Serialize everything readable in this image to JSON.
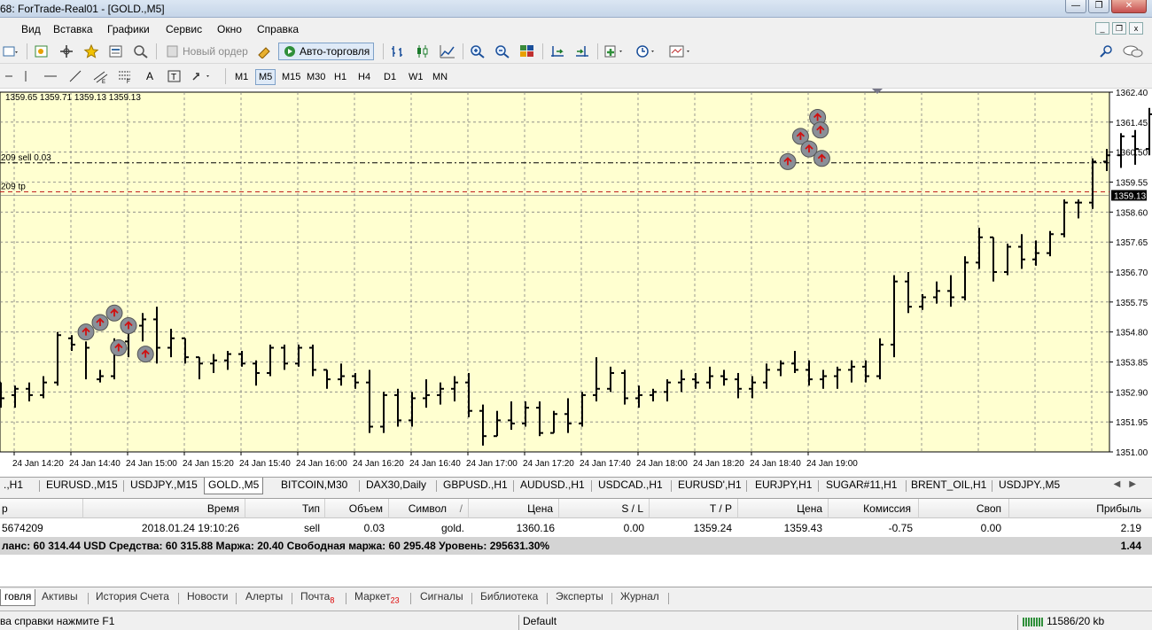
{
  "window": {
    "title": "68: ForTrade-Real01 - [GOLD.,M5]",
    "buttons": [
      "—",
      "❐",
      "✕"
    ]
  },
  "menu": [
    "Вид",
    "Вставка",
    "Графики",
    "Сервис",
    "Окно",
    "Справка"
  ],
  "toolbar1": {
    "new_order": "Новый ордер",
    "autotrading": "Авто-торговля"
  },
  "timeframes": [
    "M1",
    "M5",
    "M15",
    "M30",
    "H1",
    "H4",
    "D1",
    "W1",
    "MN"
  ],
  "active_timeframe": "M5",
  "chart": {
    "ohlc_label": "1359.65 1359.71 1359.13 1359.13",
    "order_label": "209 sell 0.03",
    "tp_label": "209 tp",
    "current_price_label": "1359.13",
    "background": "#ffffd0",
    "grid_color": "#808080",
    "candle_color": "#000000",
    "order_line_color": "#000000",
    "tp_line_color": "#c02020"
  },
  "chart_data": {
    "type": "bar",
    "title": "",
    "xlabel": "",
    "ylabel": "",
    "ylim": [
      1351.0,
      1362.4
    ],
    "y_ticks": [
      "1362.40",
      "1361.45",
      "1360.50",
      "1359.55",
      "1358.60",
      "1357.65",
      "1356.70",
      "1355.75",
      "1354.80",
      "1353.85",
      "1352.90",
      "1351.95",
      "1351.00"
    ],
    "x_ticks": [
      "24 Jan 14:20",
      "24 Jan 14:40",
      "24 Jan 15:00",
      "24 Jan 15:20",
      "24 Jan 15:40",
      "24 Jan 16:00",
      "24 Jan 16:20",
      "24 Jan 16:40",
      "24 Jan 17:00",
      "24 Jan 17:20",
      "24 Jan 17:40",
      "24 Jan 18:00",
      "24 Jan 18:20",
      "24 Jan 18:40",
      "24 Jan 19:00"
    ],
    "order_price": 1360.16,
    "tp_price": 1359.24,
    "current_price": 1359.13,
    "grid": true,
    "series": [
      {
        "bars": [
          [
            1353.2,
            1353.2,
            1352.4,
            1352.7
          ],
          [
            1352.8,
            1353.1,
            1352.4,
            1353.0
          ],
          [
            1353.0,
            1353.2,
            1352.6,
            1352.8
          ],
          [
            1352.8,
            1353.4,
            1352.7,
            1353.2
          ],
          [
            1353.2,
            1354.8,
            1353.1,
            1354.7
          ],
          [
            1354.6,
            1354.7,
            1354.2,
            1354.4
          ],
          [
            1354.6,
            1354.5,
            1353.3,
            1354.3
          ],
          [
            1353.3,
            1353.6,
            1353.2,
            1353.4
          ],
          [
            1353.4,
            1354.6,
            1353.3,
            1354.5
          ],
          [
            1354.5,
            1355.2,
            1354.0,
            1355.0
          ],
          [
            1355.0,
            1355.4,
            1354.5,
            1355.2
          ],
          [
            1355.2,
            1355.6,
            1353.8,
            1354.3
          ],
          [
            1354.3,
            1354.9,
            1354.0,
            1354.6
          ],
          [
            1354.6,
            1354.6,
            1353.8,
            1354.0
          ],
          [
            1354.0,
            1354.0,
            1353.3,
            1353.8
          ],
          [
            1353.8,
            1354.1,
            1353.5,
            1353.9
          ],
          [
            1353.9,
            1354.2,
            1353.6,
            1354.1
          ],
          [
            1354.1,
            1354.2,
            1353.7,
            1353.8
          ],
          [
            1353.8,
            1353.9,
            1353.1,
            1353.5
          ],
          [
            1353.5,
            1354.4,
            1353.4,
            1354.3
          ],
          [
            1354.3,
            1354.4,
            1353.6,
            1353.8
          ],
          [
            1353.8,
            1354.4,
            1353.7,
            1354.3
          ],
          [
            1354.3,
            1354.4,
            1353.4,
            1353.6
          ],
          [
            1353.6,
            1353.6,
            1353.0,
            1353.3
          ],
          [
            1353.3,
            1353.8,
            1353.1,
            1353.4
          ],
          [
            1353.4,
            1353.5,
            1353.0,
            1353.2
          ],
          [
            1353.2,
            1353.6,
            1351.6,
            1351.8
          ],
          [
            1351.8,
            1352.9,
            1351.6,
            1352.8
          ],
          [
            1352.8,
            1353.0,
            1351.8,
            1352.0
          ],
          [
            1352.0,
            1352.9,
            1351.8,
            1352.7
          ],
          [
            1352.7,
            1353.3,
            1352.4,
            1352.8
          ],
          [
            1352.8,
            1353.2,
            1352.5,
            1353.0
          ],
          [
            1353.0,
            1353.4,
            1352.6,
            1353.2
          ],
          [
            1353.2,
            1353.5,
            1352.1,
            1352.3
          ],
          [
            1352.3,
            1352.5,
            1351.2,
            1351.5
          ],
          [
            1351.5,
            1352.3,
            1351.5,
            1352.0
          ],
          [
            1352.0,
            1352.6,
            1351.7,
            1351.9
          ],
          [
            1351.9,
            1352.6,
            1351.8,
            1352.4
          ],
          [
            1352.4,
            1352.6,
            1351.5,
            1351.6
          ],
          [
            1351.6,
            1352.3,
            1351.6,
            1352.2
          ],
          [
            1352.2,
            1352.7,
            1351.6,
            1351.9
          ],
          [
            1351.9,
            1352.9,
            1351.8,
            1352.8
          ],
          [
            1352.8,
            1354.0,
            1352.6,
            1353.0
          ],
          [
            1353.0,
            1353.7,
            1352.9,
            1353.5
          ],
          [
            1353.5,
            1353.6,
            1352.5,
            1352.7
          ],
          [
            1352.7,
            1353.1,
            1352.4,
            1352.8
          ],
          [
            1352.8,
            1353.0,
            1352.6,
            1352.9
          ],
          [
            1352.9,
            1353.3,
            1352.6,
            1353.2
          ],
          [
            1353.2,
            1353.6,
            1352.9,
            1353.3
          ],
          [
            1353.3,
            1353.5,
            1353.0,
            1353.2
          ],
          [
            1353.2,
            1353.7,
            1353.0,
            1353.4
          ],
          [
            1353.4,
            1353.6,
            1353.1,
            1353.3
          ],
          [
            1353.3,
            1353.5,
            1352.7,
            1353.0
          ],
          [
            1353.0,
            1353.4,
            1352.7,
            1353.2
          ],
          [
            1353.2,
            1353.8,
            1353.0,
            1353.6
          ],
          [
            1353.6,
            1353.9,
            1353.4,
            1353.8
          ],
          [
            1353.8,
            1354.2,
            1353.5,
            1353.6
          ],
          [
            1353.6,
            1353.9,
            1353.1,
            1353.3
          ],
          [
            1353.3,
            1353.6,
            1353.0,
            1353.4
          ],
          [
            1353.4,
            1353.7,
            1353.0,
            1353.6
          ],
          [
            1353.6,
            1353.9,
            1353.2,
            1353.7
          ],
          [
            1353.7,
            1353.9,
            1353.2,
            1353.4
          ],
          [
            1353.4,
            1354.6,
            1353.3,
            1354.4
          ],
          [
            1354.4,
            1356.6,
            1354.0,
            1356.4
          ],
          [
            1356.4,
            1356.7,
            1355.4,
            1355.6
          ],
          [
            1355.6,
            1356.0,
            1355.5,
            1355.9
          ],
          [
            1355.9,
            1356.4,
            1355.7,
            1356.1
          ],
          [
            1356.1,
            1356.6,
            1355.6,
            1355.9
          ],
          [
            1355.9,
            1357.2,
            1355.8,
            1357.0
          ],
          [
            1357.0,
            1358.1,
            1356.8,
            1357.8
          ],
          [
            1357.8,
            1357.8,
            1356.4,
            1356.7
          ],
          [
            1356.7,
            1357.6,
            1356.6,
            1357.5
          ],
          [
            1357.5,
            1357.9,
            1356.8,
            1357.1
          ],
          [
            1357.1,
            1357.7,
            1356.9,
            1357.3
          ],
          [
            1357.3,
            1358.0,
            1357.2,
            1357.9
          ],
          [
            1357.9,
            1359.0,
            1357.8,
            1358.9
          ],
          [
            1358.9,
            1359.0,
            1358.4,
            1358.9
          ],
          [
            1358.9,
            1360.3,
            1358.7,
            1360.2
          ],
          [
            1360.2,
            1360.6,
            1359.9,
            1360.4
          ],
          [
            1360.4,
            1361.1,
            1360.0,
            1361.0
          ],
          [
            1361.0,
            1361.2,
            1360.1,
            1360.6
          ],
          [
            1360.6,
            1361.9,
            1360.4,
            1361.7
          ],
          [
            1361.7,
            1362.0,
            1359.3,
            1360.1
          ],
          [
            1360.1,
            1360.2,
            1359.4,
            1359.6
          ],
          [
            1359.6,
            1360.0,
            1359.3,
            1359.7
          ],
          [
            1359.7,
            1359.7,
            1359.1,
            1359.13
          ]
        ]
      }
    ]
  },
  "symbol_tabs": [
    ".,H1",
    "EURUSD.,M15",
    "USDJPY.,M15",
    "GOLD.,M5",
    "BITCOIN,M30",
    "DAX30,Daily",
    "GBPUSD.,H1",
    "AUDUSD.,H1",
    "USDCAD.,H1",
    "EURUSD',H1",
    "EURJPY,H1",
    "SUGAR#11,H1",
    "BRENT_OIL,H1",
    "USDJPY.,M5"
  ],
  "active_symbol_tab": "GOLD.,M5",
  "terminal": {
    "headers": [
      "р",
      "Время",
      "Тип",
      "Объем",
      "Символ",
      "Цена",
      "S / L",
      "T / P",
      "Цена",
      "Комиссия",
      "Своп",
      "Прибыль"
    ],
    "row": [
      "5674209",
      "2018.01.24 19:10:26",
      "sell",
      "0.03",
      "gold.",
      "1360.16",
      "0.00",
      "1359.24",
      "1359.43",
      "-0.75",
      "0.00",
      "2.19"
    ],
    "balance_text": "ланс: 60 314.44 USD  Средства: 60 315.88  Маржа: 20.40  Свободная маржа: 60 295.48  Уровень: 295631.30%",
    "total_profit": "1.44"
  },
  "bottom_tabs": [
    {
      "label": "говля",
      "badge": ""
    },
    {
      "label": "Активы",
      "badge": ""
    },
    {
      "label": "История Счета",
      "badge": ""
    },
    {
      "label": "Новости",
      "badge": ""
    },
    {
      "label": "Алерты",
      "badge": ""
    },
    {
      "label": "Почта",
      "badge": "8"
    },
    {
      "label": "Маркет",
      "badge": "23"
    },
    {
      "label": "Сигналы",
      "badge": ""
    },
    {
      "label": "Библиотека",
      "badge": ""
    },
    {
      "label": "Эксперты",
      "badge": ""
    },
    {
      "label": "Журнал",
      "badge": ""
    }
  ],
  "status": {
    "help": "ва справки нажмите F1",
    "profile": "Default",
    "traffic": "11586/20 kb"
  }
}
